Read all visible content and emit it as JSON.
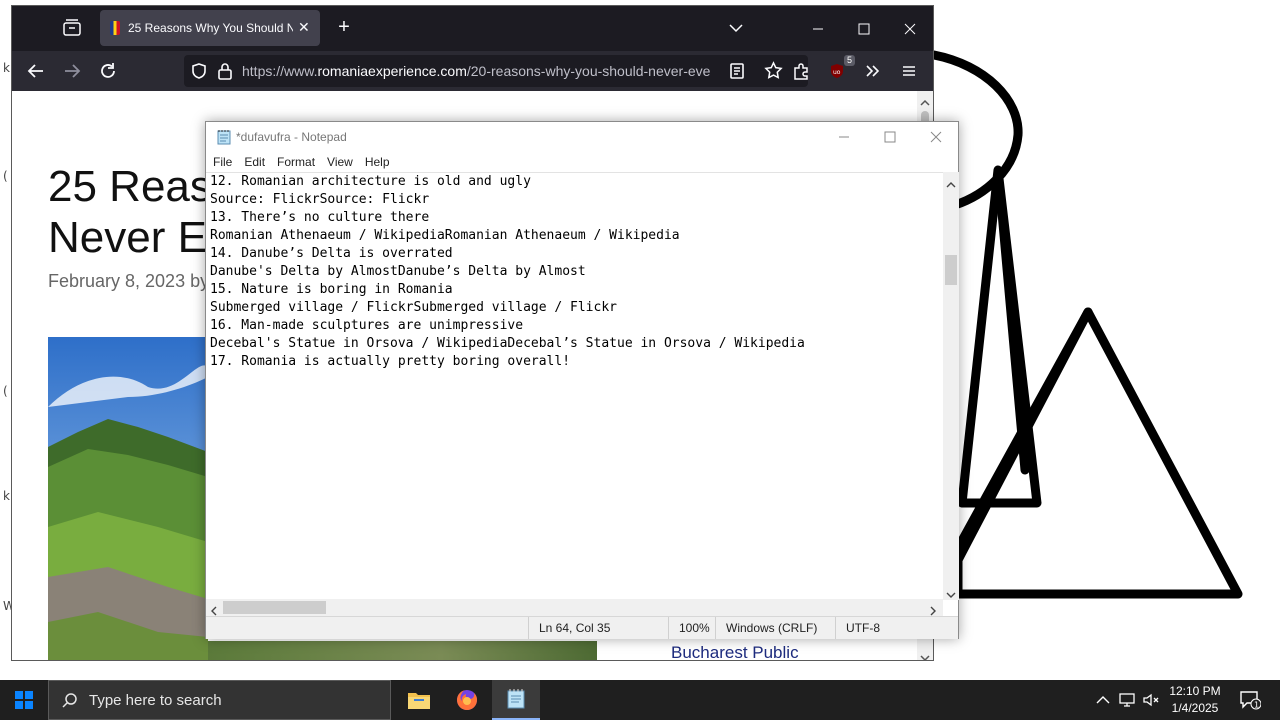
{
  "firefox": {
    "tab_title": "25 Reasons Why You Should Ne",
    "url_prefix": "https://www.",
    "url_host": "romaniaexperience.com",
    "url_path": "/20-reasons-why-you-should-never-eve",
    "extension_badge": "5",
    "page": {
      "title_line1": "25 Reaso",
      "title_line2": "Never EV",
      "date": "February 8, 2023 by",
      "sidebar_link": "Bucharest Public"
    }
  },
  "notepad": {
    "title": "*dufavufra - Notepad",
    "menu": [
      "File",
      "Edit",
      "Format",
      "View",
      "Help"
    ],
    "lines": [
      "12. Romanian architecture is old and ugly",
      "Source: FlickrSource: Flickr",
      "13. There’s no culture there",
      "Romanian Athenaeum / WikipediaRomanian Athenaeum / Wikipedia",
      "14. Danube’s Delta is overrated",
      "Danube's Delta by AlmostDanube’s Delta by Almost",
      "15. Nature is boring in Romania",
      "Submerged village / FlickrSubmerged village / Flickr",
      "16. Man-made sculptures are unimpressive",
      "Decebal's Statue in Orsova / WikipediaDecebal’s Statue in Orsova / Wikipedia",
      "17. Romania is actually pretty boring overall!"
    ],
    "status": {
      "position": "Ln 64, Col 35",
      "zoom": "100%",
      "line_ending": "Windows (CRLF)",
      "encoding": "UTF-8"
    }
  },
  "taskbar": {
    "search_placeholder": "Type here to search",
    "time": "12:10 PM",
    "date": "1/4/2025",
    "notification_count": "1"
  },
  "colors": {
    "firefox_tabbar": "#1c1b22",
    "firefox_navbar": "#2b2a33",
    "taskbar": "#1f1f1f",
    "link": "#1d2b7e"
  }
}
